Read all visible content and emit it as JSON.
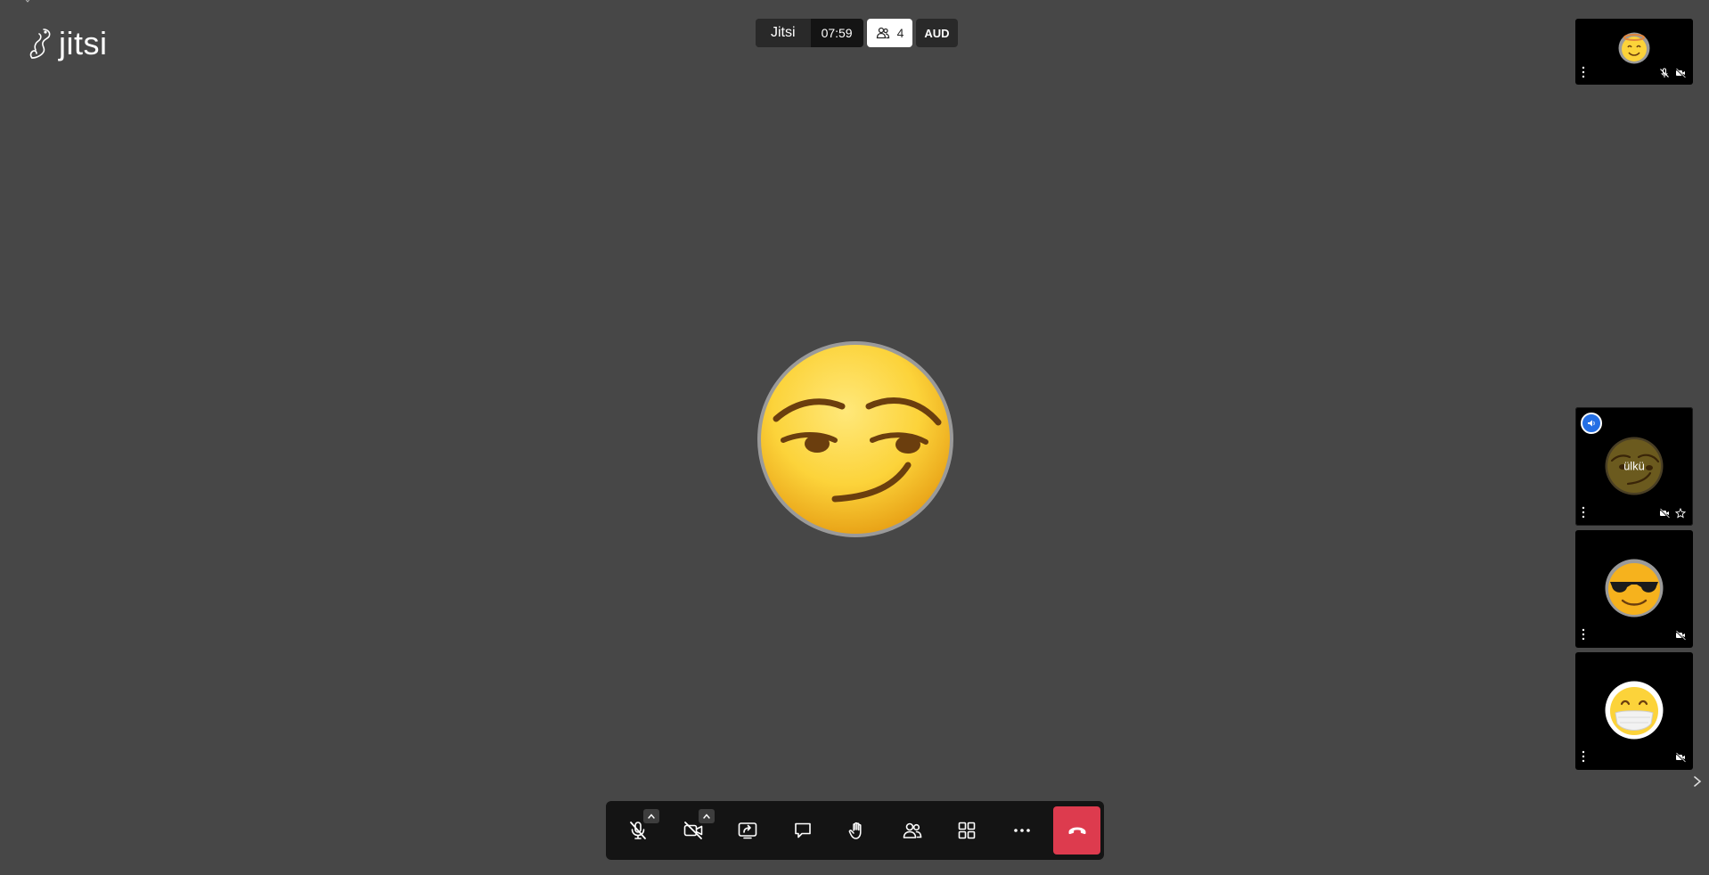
{
  "app": {
    "logo_text": "jitsi"
  },
  "subject": {
    "title": "Jitsi",
    "timer": "07:59",
    "participants_count": "4",
    "audio_label": "AUD"
  },
  "main_stage": {
    "avatar_icon": "smirking-face-emoji"
  },
  "filmstrip": {
    "tiles": [
      {
        "avatar_icon": "smiling-face-with-halo-emoji",
        "display_name": "",
        "status": [
          "mic-muted-icon",
          "video-off-icon"
        ]
      },
      {
        "avatar_icon": "smirking-face-emoji",
        "display_name": "ülkü",
        "dominant_speaker": true,
        "status": [
          "video-off-icon",
          "star-icon"
        ]
      },
      {
        "avatar_icon": "smiling-face-with-sunglasses-emoji",
        "display_name": "",
        "status": [
          "video-off-icon"
        ]
      },
      {
        "avatar_icon": "face-with-medical-mask-emoji",
        "display_name": "",
        "status": [
          "video-off-icon"
        ]
      }
    ]
  },
  "toolbar": {
    "buttons": [
      {
        "name": "microphone-muted-icon",
        "has_caret": true
      },
      {
        "name": "camera-off-icon",
        "has_caret": true
      },
      {
        "name": "screen-share-icon"
      },
      {
        "name": "chat-icon"
      },
      {
        "name": "raise-hand-icon"
      },
      {
        "name": "participants-icon"
      },
      {
        "name": "tile-view-icon"
      },
      {
        "name": "more-actions-icon"
      },
      {
        "name": "hangup-icon"
      }
    ],
    "hangup_color": "#dd3b4e"
  },
  "colors": {
    "background": "#474747",
    "toolbar": "#141414",
    "dominant_badge": "#246fe5"
  }
}
